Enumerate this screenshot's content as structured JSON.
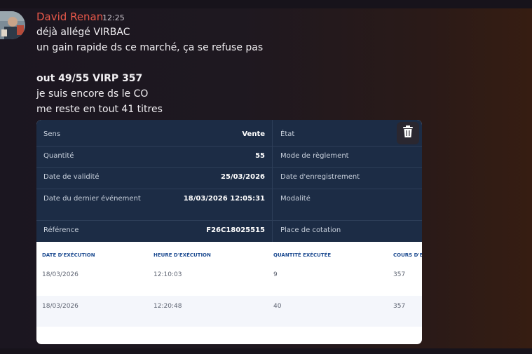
{
  "message": {
    "author": "David Renan",
    "time": "12:25",
    "lines": [
      "déjà allégé VIRBAC",
      "un gain rapide ds ce marché, ça se refuse pas",
      "out 49/55 VIRP 357",
      "je suis encore ds le CO",
      "me reste en tout 41 titres"
    ]
  },
  "order": {
    "left": [
      {
        "label": "Sens",
        "value": "Vente"
      },
      {
        "label": "Quantité",
        "value": "55"
      },
      {
        "label": "Date de validité",
        "value": "25/03/2026"
      },
      {
        "label": "Date du dernier événement",
        "value": "18/03/2026 12:05:31"
      },
      {
        "label": "Référence",
        "value": "F26C18025515"
      }
    ],
    "right": [
      {
        "label": "État"
      },
      {
        "label": "Mode de règlement"
      },
      {
        "label": "Date d'enregistrement"
      },
      {
        "label": "Modalité"
      },
      {
        "label": "Place de cotation"
      }
    ],
    "delete_icon": "trash-icon"
  },
  "executions": {
    "headers": [
      "DATE D'EXÉCUTION",
      "HEURE D'EXÉCUTION",
      "QUANTITÉ EXÉCUTÉE",
      "COURS D'EX"
    ],
    "rows": [
      [
        "18/03/2026",
        "12:10:03",
        "9",
        "357"
      ],
      [
        "18/03/2026",
        "12:20:48",
        "40",
        "357"
      ]
    ]
  },
  "colors": {
    "author": "#e8584a",
    "panel": "#1c2c45",
    "header_text": "#1f4d92"
  }
}
